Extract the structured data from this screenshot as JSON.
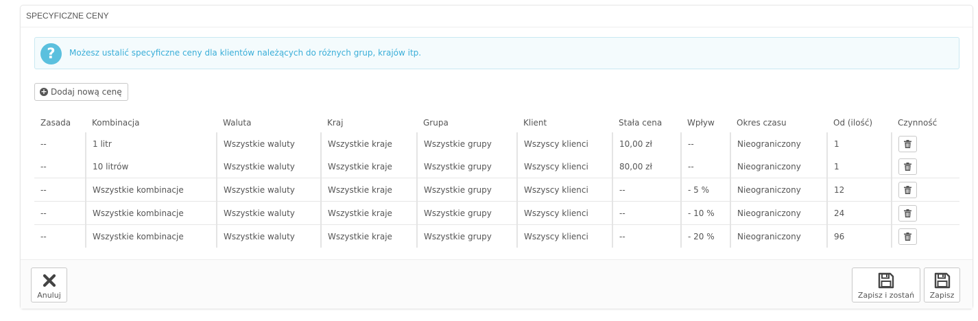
{
  "panel": {
    "title": "SPECYFICZNE CENY"
  },
  "alert": {
    "icon": "question-circle-icon",
    "text": "Możesz ustalić specyficzne ceny dla klientów należących do różnych grup, krajów itp.",
    "color": "#3aaed8"
  },
  "add_button": {
    "icon": "plus-circle-icon",
    "label": "Dodaj nową cenę"
  },
  "table": {
    "columns": [
      "Zasada",
      "Kombinacja",
      "Waluta",
      "Kraj",
      "Grupa",
      "Klient",
      "Stała cena",
      "Wpływ",
      "Okres czasu",
      "Od (ilość)",
      "Czynność"
    ],
    "rows": [
      {
        "rule": "--",
        "combination": "1 litr",
        "currency": "Wszystkie waluty",
        "country": "Wszystkie kraje",
        "group": "Wszystkie grupy",
        "customer": "Wszyscy klienci",
        "fixed_price": "10,00 zł",
        "impact": "--",
        "period": "Nieograniczony",
        "from_qty": "1"
      },
      {
        "rule": "--",
        "combination": "10 litrów",
        "currency": "Wszystkie waluty",
        "country": "Wszystkie kraje",
        "group": "Wszystkie grupy",
        "customer": "Wszyscy klienci",
        "fixed_price": "80,00 zł",
        "impact": "--",
        "period": "Nieograniczony",
        "from_qty": "1"
      },
      {
        "rule": "--",
        "combination": "Wszystkie kombinacje",
        "currency": "Wszystkie waluty",
        "country": "Wszystkie kraje",
        "group": "Wszystkie grupy",
        "customer": "Wszyscy klienci",
        "fixed_price": "--",
        "impact": "- 5 %",
        "period": "Nieograniczony",
        "from_qty": "12"
      },
      {
        "rule": "--",
        "combination": "Wszystkie kombinacje",
        "currency": "Wszystkie waluty",
        "country": "Wszystkie kraje",
        "group": "Wszystkie grupy",
        "customer": "Wszyscy klienci",
        "fixed_price": "--",
        "impact": "- 10 %",
        "period": "Nieograniczony",
        "from_qty": "24"
      },
      {
        "rule": "--",
        "combination": "Wszystkie kombinacje",
        "currency": "Wszystkie waluty",
        "country": "Wszystkie kraje",
        "group": "Wszystkie grupy",
        "customer": "Wszyscy klienci",
        "fixed_price": "--",
        "impact": "- 20 %",
        "period": "Nieograniczony",
        "from_qty": "96"
      }
    ],
    "action_icon": "trash-icon"
  },
  "footer": {
    "cancel": {
      "label": "Anuluj",
      "icon": "close-icon"
    },
    "save_and_stay": {
      "label": "Zapisz i zostań",
      "icon": "save-icon"
    },
    "save": {
      "label": "Zapisz",
      "icon": "save-icon"
    }
  }
}
